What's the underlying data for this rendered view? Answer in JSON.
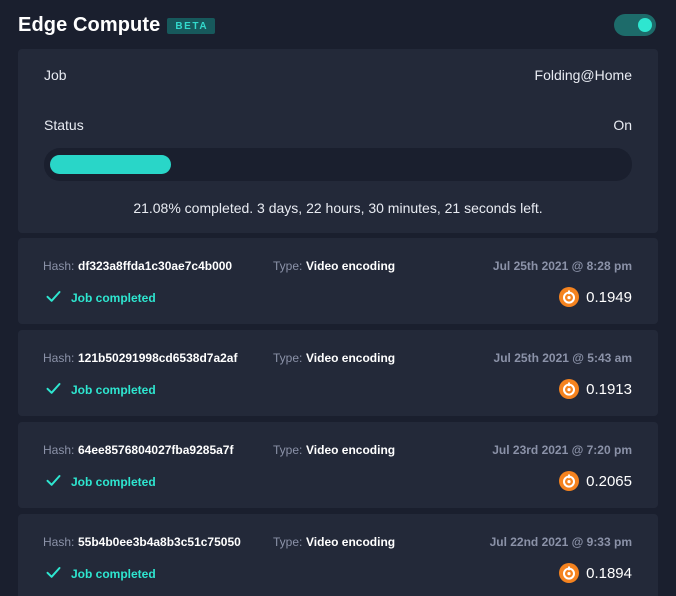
{
  "header": {
    "title": "Edge Compute",
    "badge": "BETA",
    "toggle_on": true
  },
  "job_panel": {
    "job_label": "Job",
    "job_value": "Folding@Home",
    "status_label": "Status",
    "status_value": "On",
    "progress_percent": 21.08,
    "progress_text": "21.08% completed. 3 days, 22 hours, 30 minutes, 21 seconds left."
  },
  "labels": {
    "hash": "Hash:",
    "type": "Type:"
  },
  "jobs": [
    {
      "hash": "df323a8ffda1c30ae7c4b000",
      "type": "Video encoding",
      "date": "Jul 25th 2021 @ 8:28 pm",
      "status": "Job completed",
      "amount": "0.1949"
    },
    {
      "hash": "121b50291998cd6538d7a2af",
      "type": "Video encoding",
      "date": "Jul 25th 2021 @ 5:43 am",
      "status": "Job completed",
      "amount": "0.1913"
    },
    {
      "hash": "64ee8576804027fba9285a7f",
      "type": "Video encoding",
      "date": "Jul 23rd 2021 @ 7:20 pm",
      "status": "Job completed",
      "amount": "0.2065"
    },
    {
      "hash": "55b4b0ee3b4a8b3c51c75050",
      "type": "Video encoding",
      "date": "Jul 22nd 2021 @ 9:33 pm",
      "status": "Job completed",
      "amount": "0.1894"
    }
  ],
  "colors": {
    "background": "#1a1f2e",
    "panel": "#232939",
    "accent": "#2ee6d0",
    "coin": "#f5831f"
  },
  "icons": {
    "status": "check-icon",
    "amount": "coin-icon"
  }
}
